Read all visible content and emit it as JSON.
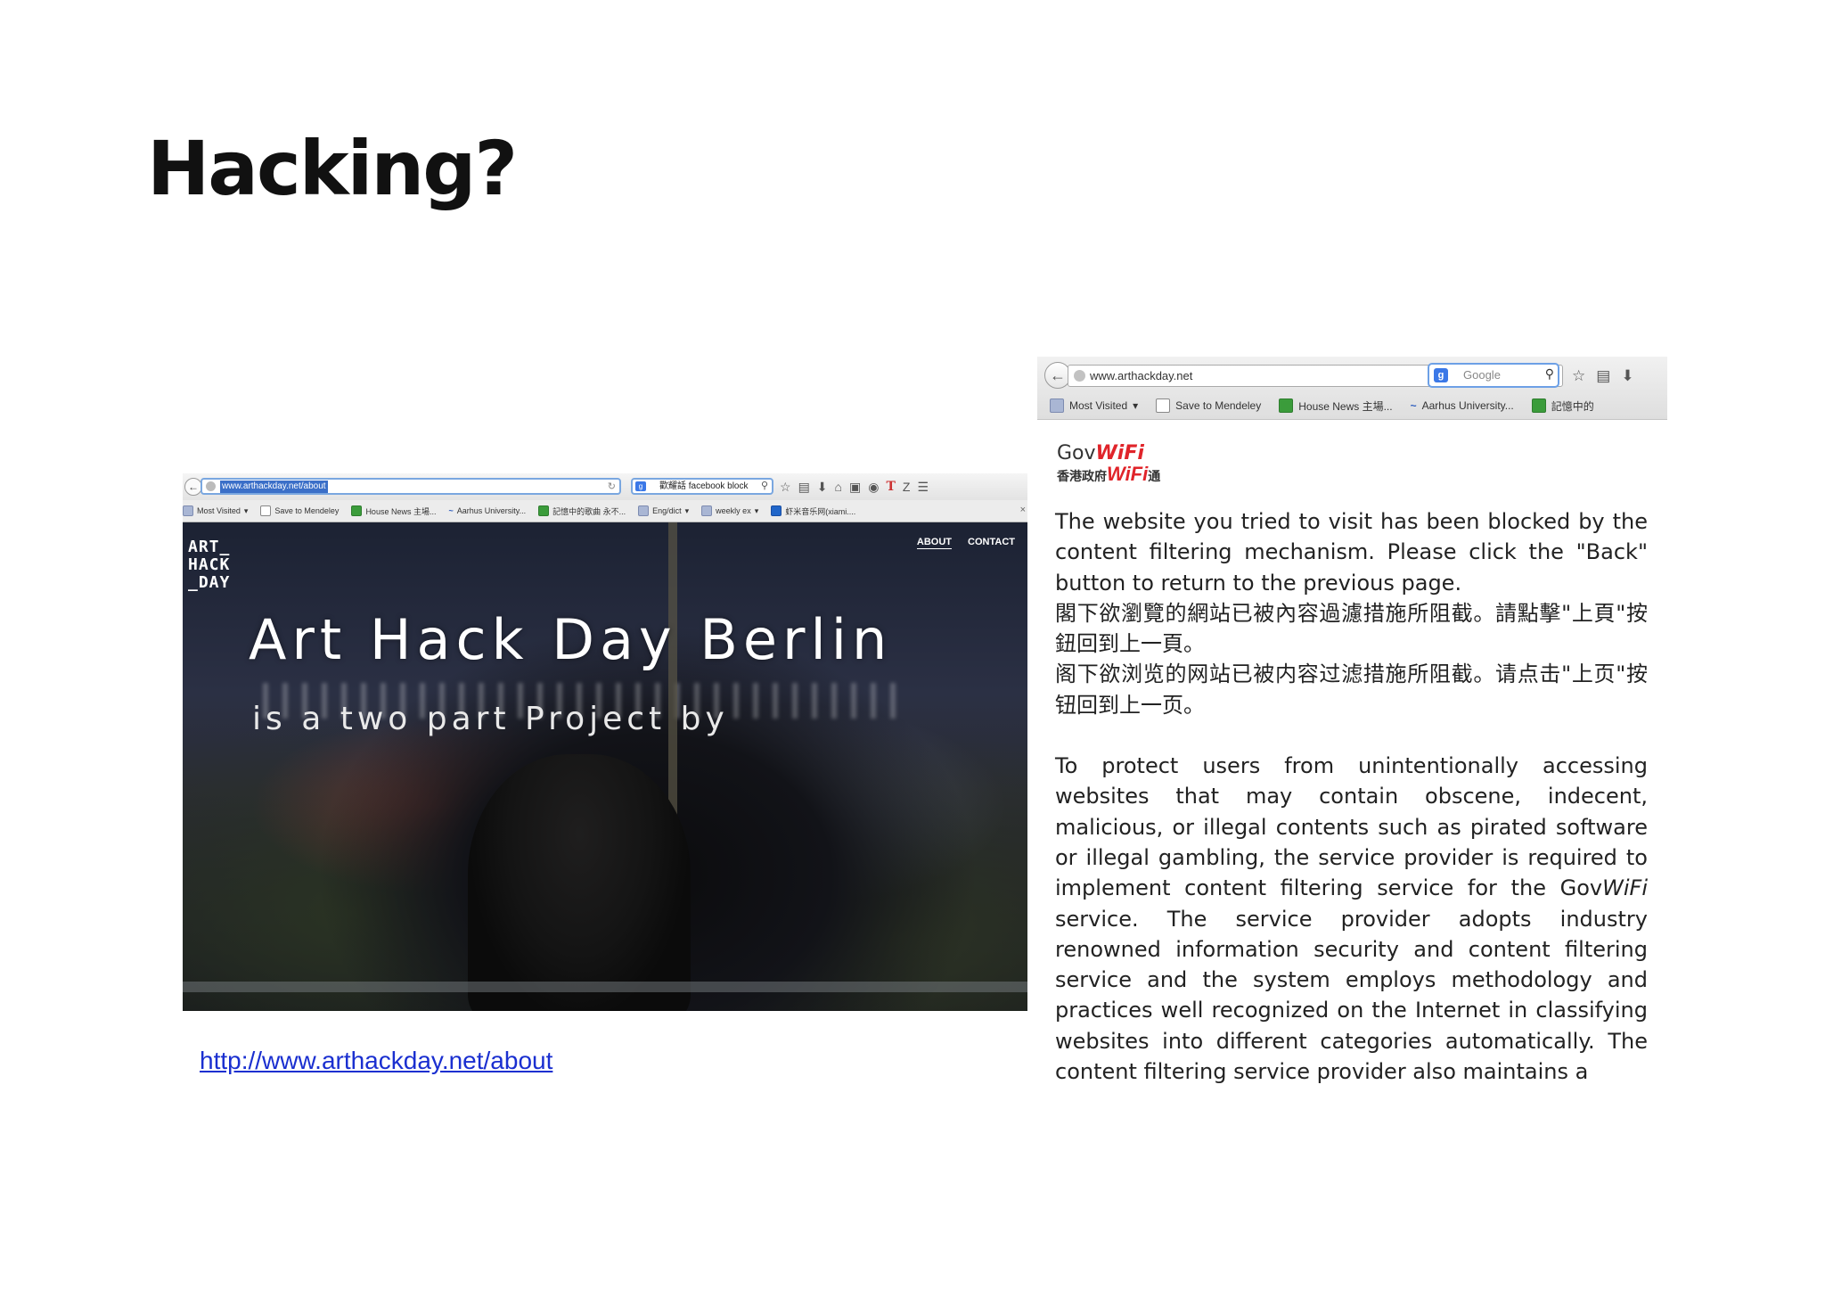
{
  "slide": {
    "title": "Hacking?"
  },
  "left_shot": {
    "browser": {
      "url": "www.arthackday.net/about",
      "search_text": "歡耀話 facebook block",
      "bookmarks": [
        "Most Visited",
        "Save to Mendeley",
        "House News 主場...",
        "Aarhus University...",
        "記憶中的歌曲 永不...",
        "Eng/dict",
        "weekly ex",
        "虾米音乐网(xiami...."
      ]
    },
    "site": {
      "logo_lines": [
        "ART_",
        "HACK",
        "_DAY"
      ],
      "nav": {
        "about": "ABOUT",
        "contact": "CONTACT"
      },
      "hero_title": "Art Hack Day Berlin",
      "hero_subtitle": "is a two part Project by"
    }
  },
  "link": {
    "text": "http://www.arthackday.net/about"
  },
  "right_shot": {
    "browser": {
      "url": "www.arthackday.net",
      "search_placeholder": "Google",
      "bookmarks": [
        "Most Visited",
        "Save to Mendeley",
        "House News 主場...",
        "Aarhus University...",
        "記憶中的"
      ]
    },
    "logo": {
      "gov": "Gov",
      "wifi": "WiFi",
      "zh_prefix": "香港政府",
      "zh_suffix": "通"
    },
    "notice": {
      "en_blocked": "The website you tried to visit has been blocked by the content filtering mechanism. Please click the \"Back\" button to return to the previous page.",
      "zh_trad": "閣下欲瀏覽的網站已被內容過濾措施所阻截。請點擊\"上頁\"按鈕回到上一頁。",
      "zh_simp": "阁下欲浏览的网站已被内容过滤措施所阻截。请点击\"上页\"按钮回到上一页。",
      "para_part1": "To protect users from unintentionally accessing websites that may contain obscene, indecent, malicious, or illegal contents such as pirated software or illegal gambling, the service provider is required to implement content filtering service for the Gov",
      "para_wifi": "WiFi",
      "para_part2": " service. The service provider adopts industry renowned information security and content filtering service and the system employs methodology and practices well recognized on the Internet in classifying websites into different categories automatically. The content filtering service provider also maintains a"
    }
  }
}
